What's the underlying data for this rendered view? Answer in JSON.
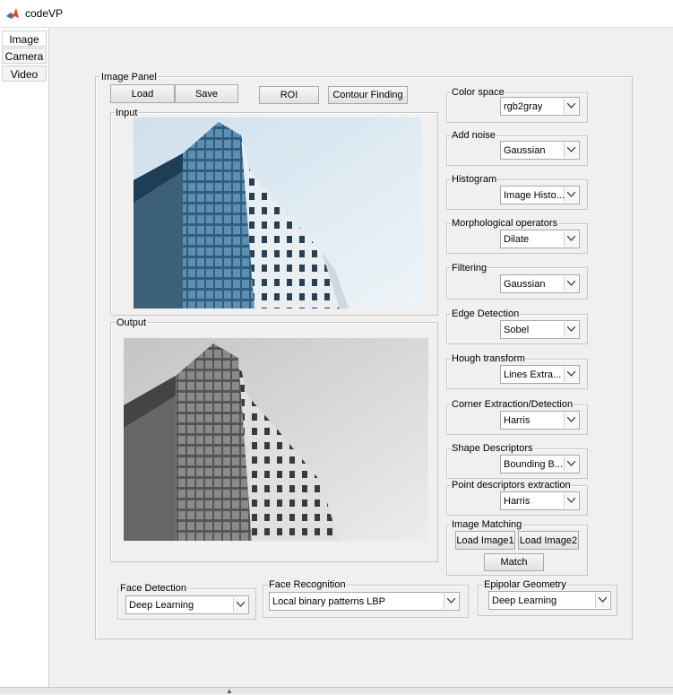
{
  "window": {
    "title": "codeVP"
  },
  "sidebar": {
    "tabs": [
      {
        "label": "Image"
      },
      {
        "label": "Camera"
      },
      {
        "label": "Video"
      }
    ]
  },
  "image_panel": {
    "title": "Image Panel",
    "buttons": {
      "load": "Load",
      "save": "Save",
      "roi": "ROI",
      "contour": "Contour Finding"
    },
    "input_title": "Input",
    "output_title": "Output"
  },
  "controls": {
    "color_space": {
      "title": "Color space",
      "value": "rgb2gray"
    },
    "add_noise": {
      "title": "Add noise",
      "value": "Gaussian"
    },
    "histogram": {
      "title": "Histogram",
      "value": "Image Histo..."
    },
    "morph": {
      "title": "Morphological operators",
      "value": "Dilate"
    },
    "filtering": {
      "title": "Filtering",
      "value": "Gaussian"
    },
    "edge": {
      "title": "Edge Detection",
      "value": "Sobel"
    },
    "hough": {
      "title": "Hough transform",
      "value": "Lines Extra..."
    },
    "corner": {
      "title": "Corner Extraction/Detection",
      "value": "Harris"
    },
    "shape": {
      "title": "Shape Descriptors",
      "value": "Bounding B..."
    },
    "point": {
      "title": "Point descriptors extraction",
      "value": "Harris"
    },
    "matching": {
      "title": "Image Matching",
      "load1": "Load Image1",
      "load2": "Load Image2",
      "match": "Match"
    }
  },
  "bottom": {
    "face_detection": {
      "title": "Face Detection",
      "value": "Deep Learning"
    },
    "face_recognition": {
      "title": "Face Recognition",
      "value": "Local binary patterns LBP"
    },
    "epipolar": {
      "title": "Epipolar Geometry",
      "value": "Deep Learning"
    }
  },
  "colors": {
    "background": "#f0f0f0",
    "sky": "#dfeaf1",
    "glass": "#3f6c8c"
  }
}
